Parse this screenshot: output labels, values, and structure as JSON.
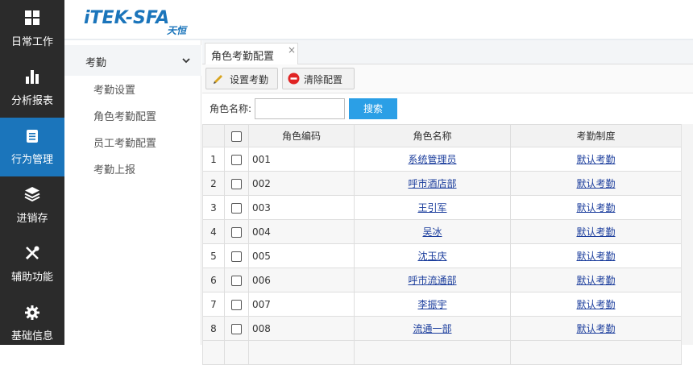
{
  "nav": {
    "items": [
      {
        "label": "日常工作",
        "icon": "grid-icon"
      },
      {
        "label": "分析报表",
        "icon": "bar-chart-icon"
      },
      {
        "label": "行为管理",
        "icon": "document-icon",
        "active": true
      },
      {
        "label": "进销存",
        "icon": "layers-icon"
      },
      {
        "label": "辅助功能",
        "icon": "tools-icon"
      },
      {
        "label": "基础信息",
        "icon": "gear-icon"
      }
    ]
  },
  "logo": {
    "brand": "iTEK-SFA",
    "sub": "天恒"
  },
  "submenu": {
    "title": "考勤",
    "links": [
      "考勤设置",
      "角色考勤配置",
      "员工考勤配置",
      "考勤上报"
    ]
  },
  "tab": {
    "label": "角色考勤配置",
    "close": "×"
  },
  "toolbar": {
    "setup_label": "设置考勤",
    "clear_label": "清除配置"
  },
  "search": {
    "label": "角色名称:",
    "value": "",
    "button": "搜索"
  },
  "table": {
    "headers": [
      "角色编码",
      "角色名称",
      "考勤制度"
    ],
    "rows": [
      {
        "num": "1",
        "code": "001",
        "name": "系统管理员",
        "policy": "默认考勤"
      },
      {
        "num": "2",
        "code": "002",
        "name": "呼市酒店部",
        "policy": "默认考勤"
      },
      {
        "num": "3",
        "code": "003",
        "name": "王引军",
        "policy": "默认考勤"
      },
      {
        "num": "4",
        "code": "004",
        "name": "吴冰",
        "policy": "默认考勤"
      },
      {
        "num": "5",
        "code": "005",
        "name": "沈玉庆",
        "policy": "默认考勤"
      },
      {
        "num": "6",
        "code": "006",
        "name": "呼市流通部",
        "policy": "默认考勤"
      },
      {
        "num": "7",
        "code": "007",
        "name": "李振宇",
        "policy": "默认考勤"
      },
      {
        "num": "8",
        "code": "008",
        "name": "流通一部",
        "policy": "默认考勤"
      }
    ]
  },
  "colors": {
    "nav_bg": "#2b2b2b",
    "nav_active": "#1b75bb",
    "brand": "#1b75bb",
    "search_btn": "#2b9fe6",
    "link": "#1a3c9c",
    "clear_icon": "#e02424",
    "setup_icon": "#d9a520"
  }
}
